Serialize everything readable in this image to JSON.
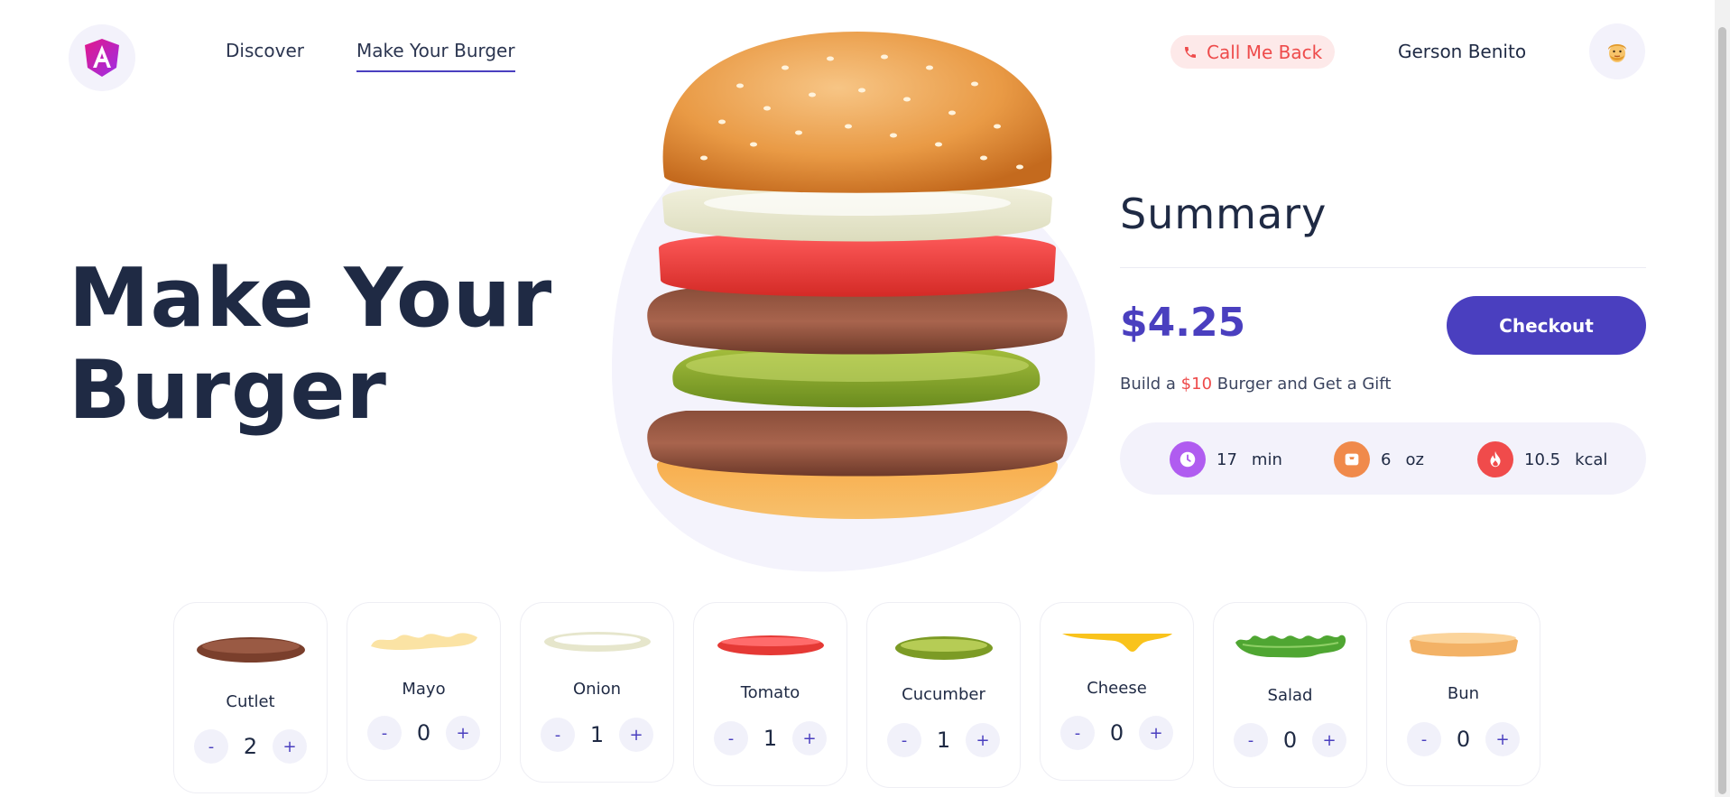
{
  "nav": {
    "logo_icon": "angular-logo-icon",
    "discover": "Discover",
    "make_your_burger": "Make Your Burger"
  },
  "header": {
    "call_me_back": "Call Me Back",
    "call_icon": "phone-icon",
    "user_name": "Gerson Benito",
    "avatar_icon": "user-avatar-emoji"
  },
  "hero": {
    "title_line1": "Make Your",
    "title_line2": "Burger"
  },
  "summary": {
    "title": "Summary",
    "price": "$4.25",
    "checkout_label": "Checkout",
    "promo_before": "Build a ",
    "promo_amount": "$10",
    "promo_after": " Burger and Get a Gift",
    "stats": [
      {
        "icon": "clock-icon",
        "value": "17",
        "unit": "min",
        "color": "#b05cf0"
      },
      {
        "icon": "scale-icon",
        "value": "6",
        "unit": "oz",
        "color": "#f08a4b"
      },
      {
        "icon": "flame-icon",
        "value": "10.5",
        "unit": "kcal",
        "color": "#f04b4b"
      }
    ]
  },
  "ingredients": [
    {
      "name": "Cutlet",
      "count": "2",
      "minus": "-",
      "plus": "+"
    },
    {
      "name": "Mayo",
      "count": "0",
      "minus": "-",
      "plus": "+"
    },
    {
      "name": "Onion",
      "count": "1",
      "minus": "-",
      "plus": "+"
    },
    {
      "name": "Tomato",
      "count": "1",
      "minus": "-",
      "plus": "+"
    },
    {
      "name": "Cucumber",
      "count": "1",
      "minus": "-",
      "plus": "+"
    },
    {
      "name": "Cheese",
      "count": "0",
      "minus": "-",
      "plus": "+"
    },
    {
      "name": "Salad",
      "count": "0",
      "minus": "-",
      "plus": "+"
    },
    {
      "name": "Bun",
      "count": "0",
      "minus": "-",
      "plus": "+"
    }
  ],
  "colors": {
    "accent": "#4a3fbf",
    "danger": "#ee4b4b",
    "text": "#1f2a44",
    "soft_bg": "#f3f2fb"
  }
}
